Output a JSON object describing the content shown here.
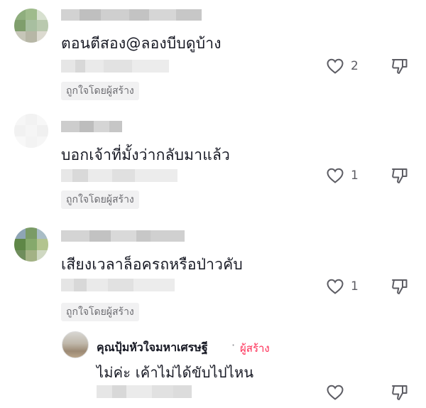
{
  "comments": [
    {
      "text": "ตอนตีสอง@ลองบีบดูบ้าง",
      "creator_liked": "ถูกใจโดยผู้สร้าง",
      "like_count": "2"
    },
    {
      "text": "บอกเจ้าที่มั้งว่ากลับมาแล้ว",
      "creator_liked": "ถูกใจโดยผู้สร้าง",
      "like_count": "1"
    },
    {
      "text": "เสียงเวลาล็อครถหรือป่าวคับ",
      "creator_liked": "ถูกใจโดยผู้สร้าง",
      "like_count": "1"
    }
  ],
  "reply": {
    "username": "คุณปุ้มหัวใจมหาเศรษฐี",
    "separator": "·",
    "badge": "ผู้สร้าง",
    "text": "ไม่ค่ะ เค้าไม่ได้ขับไปไหน",
    "like_count": ""
  },
  "icons": {
    "like": "heart-outline-icon",
    "dislike": "thumbs-down-outline-icon"
  },
  "colors": {
    "creator_badge": "#fe2c55",
    "text": "#161823",
    "secondary": "#6b6b70"
  }
}
